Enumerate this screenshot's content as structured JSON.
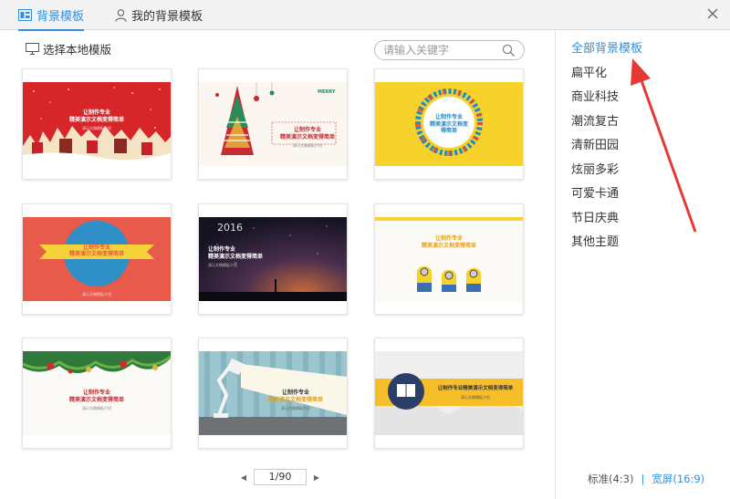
{
  "tabs": [
    {
      "label": "背景模板",
      "icon": "template-icon",
      "active": true
    },
    {
      "label": "我的背景模板",
      "icon": "user-icon",
      "active": false
    }
  ],
  "toolbar": {
    "local_label": "选择本地模版",
    "search_placeholder": "请输入关键字"
  },
  "templates": [
    {
      "title_line1": "让制作专业",
      "title_line2": "精美演示文档变得简单",
      "subtitle": "演示文稿模板介绍",
      "style": "christmas-red-town"
    },
    {
      "title_line1": "让制作专业",
      "title_line2": "精美演示文档变得简单",
      "subtitle": "演示文稿模板介绍",
      "style": "christmas-tree",
      "badge": "MERRY"
    },
    {
      "title_line1": "让制作专业",
      "title_line2": "精美演示文档变得简单",
      "subtitle": "",
      "style": "yellow-circle"
    },
    {
      "title_line1": "让制作专业",
      "title_line2": "精美演示文档变得简单",
      "subtitle": "演示文稿模板介绍",
      "style": "ribbon-red"
    },
    {
      "title_line1": "让制作专业",
      "title_line2": "精美演示文档变得简单",
      "subtitle": "演示文稿模板介绍",
      "style": "starry-night",
      "badge": "2016"
    },
    {
      "title_line1": "让制作专业",
      "title_line2": "精美演示文档变得简单",
      "subtitle": "",
      "style": "minions"
    },
    {
      "title_line1": "让制作专业",
      "title_line2": "精美演示文档变得简单",
      "subtitle": "演示文稿模板介绍",
      "style": "holly-wreath"
    },
    {
      "title_line1": "让制作专业",
      "title_line2": "精美演示文档变得简单",
      "subtitle": "演示文稿模板介绍",
      "style": "desk-lamp"
    },
    {
      "title_line1": "让制作专业精美演示文档变得简单",
      "title_line2": "",
      "subtitle": "演示文稿模板介绍",
      "style": "yellow-band"
    }
  ],
  "categories": [
    {
      "label": "全部背景模板",
      "active": true
    },
    {
      "label": "扁平化",
      "active": false
    },
    {
      "label": "商业科技",
      "active": false
    },
    {
      "label": "潮流复古",
      "active": false
    },
    {
      "label": "清新田园",
      "active": false
    },
    {
      "label": "炫丽多彩",
      "active": false
    },
    {
      "label": "可爱卡通",
      "active": false
    },
    {
      "label": "节日庆典",
      "active": false
    },
    {
      "label": "其他主题",
      "active": false
    }
  ],
  "pager": {
    "value": "1/90",
    "prev": "◀",
    "next": "▶"
  },
  "ratio": {
    "standard": "标准(4:3)",
    "separator": "|",
    "wide": "宽屏(16:9)"
  },
  "colors": {
    "accent": "#2f8fe0",
    "annotation_arrow": "#e53935"
  }
}
